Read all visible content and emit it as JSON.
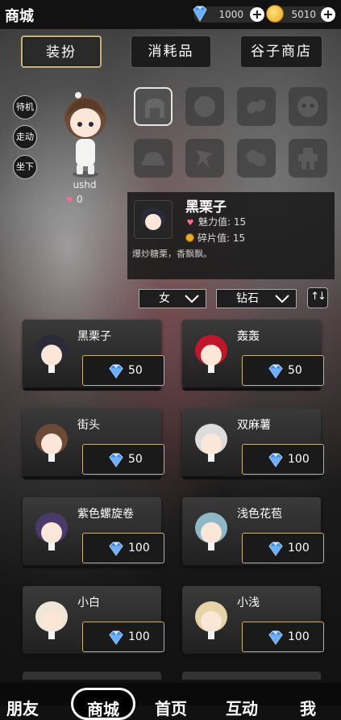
{
  "header": {
    "title": "商城"
  },
  "currency": {
    "diamonds": "1000",
    "coins": "5010"
  },
  "tabs": [
    "装扮",
    "消耗品",
    "谷子商店"
  ],
  "actions": [
    "待机",
    "走动",
    "坐下"
  ],
  "profile": {
    "username": "ushd",
    "charm": "0"
  },
  "detail": {
    "name": "黑栗子",
    "charm_label": "魅力值: 15",
    "fragment_label": "碎片值: 15",
    "description": "爆炒糖栗，香飘飘。"
  },
  "filters": {
    "gender": "女",
    "currency": "钻石"
  },
  "items": [
    {
      "name": "黑栗子",
      "price": "50",
      "hair": "#2a2a38"
    },
    {
      "name": "轰轰",
      "price": "50",
      "hair": "#c3152a"
    },
    {
      "name": "街头",
      "price": "50",
      "hair": "#6b4a36"
    },
    {
      "name": "双麻薯",
      "price": "100",
      "hair": "#dcdcdc"
    },
    {
      "name": "紫色螺旋卷",
      "price": "100",
      "hair": "#4a3a6a"
    },
    {
      "name": "浅色花苞",
      "price": "100",
      "hair": "#8fb8c6"
    },
    {
      "name": "小白",
      "price": "100",
      "hair": "#efe6d8"
    },
    {
      "name": "小浅",
      "price": "100",
      "hair": "#e6d3a6"
    }
  ],
  "nav": [
    "朋友",
    "商城",
    "首页",
    "互动",
    "我"
  ],
  "colors": {
    "accent": "#c9b27a",
    "diamond": "#3d8bf0"
  }
}
